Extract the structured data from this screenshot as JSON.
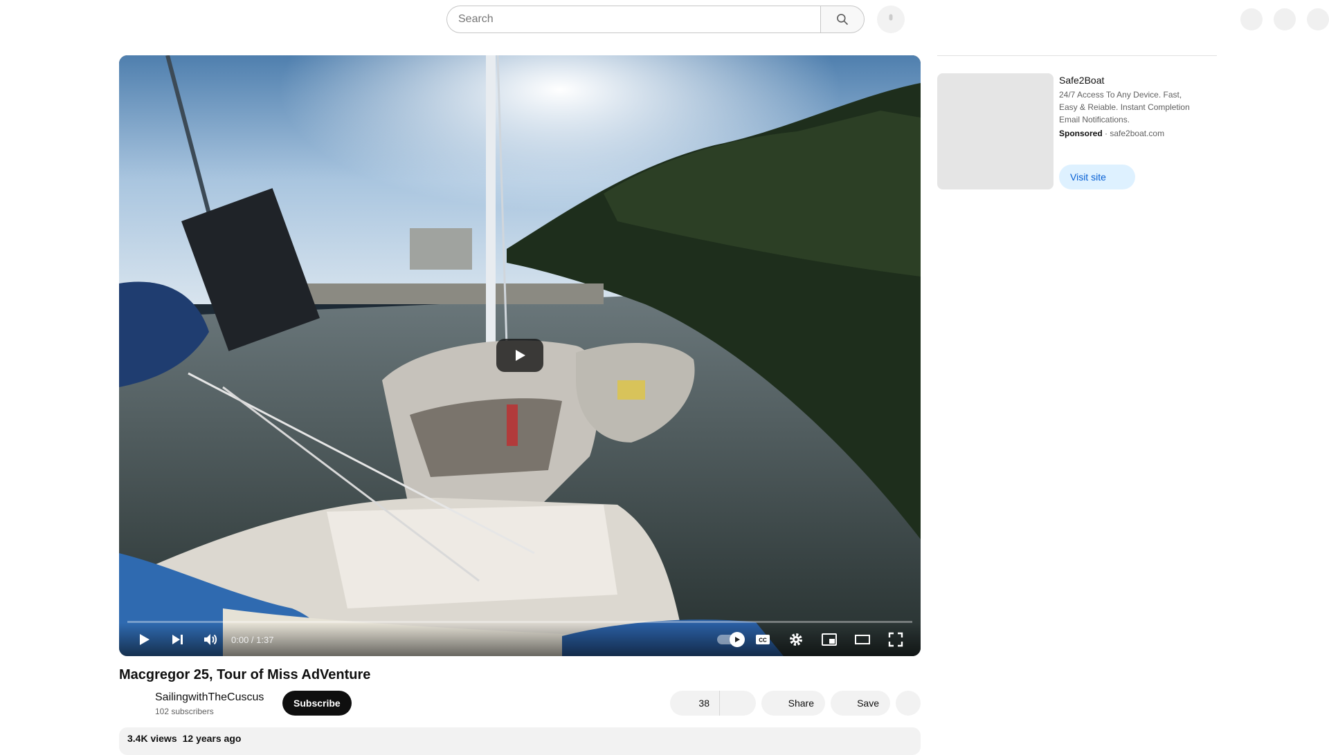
{
  "search": {
    "placeholder": "Search"
  },
  "player": {
    "current_time": "0:00",
    "duration": "1:37",
    "time_display": "0:00 / 1:37",
    "progress_fraction": 0
  },
  "video": {
    "title": "Macgregor 25, Tour of Miss AdVenture",
    "channel_name": "SailingwithTheCuscus",
    "subscribers": "102 subscribers",
    "subscribe_label": "Subscribe",
    "like_count": "38",
    "share_label": "Share",
    "save_label": "Save",
    "views": "3.4K views",
    "age": "12 years ago"
  },
  "ad": {
    "title": "Safe2Boat",
    "body": "24/7 Access To Any Device. Fast, Easy & Reiable. Instant Completion Email Notifications.",
    "sponsored_label": "Sponsored",
    "separator": "·",
    "domain": "safe2boat.com",
    "cta_label": "Visit site"
  },
  "colors": {
    "subscribe_bg": "#0f0f0f",
    "visit_bg": "#def1ff",
    "visit_text": "#065fd4",
    "progress_played": "#ff0000"
  },
  "icons": {
    "search": "search-icon",
    "mic": "mic-icon",
    "create": "create-icon",
    "notifications": "bell-icon",
    "account": "avatar-icon",
    "play": "play-icon",
    "next": "next-icon",
    "volume": "volume-icon",
    "autoplay": "autoplay-toggle-icon",
    "captions": "captions-icon",
    "settings": "settings-icon",
    "miniplayer": "miniplayer-icon",
    "theater": "theater-icon",
    "fullscreen": "fullscreen-icon",
    "like": "thumbs-up-icon",
    "dislike": "thumbs-down-icon",
    "share": "share-icon",
    "save": "save-icon",
    "more": "more-icon"
  }
}
